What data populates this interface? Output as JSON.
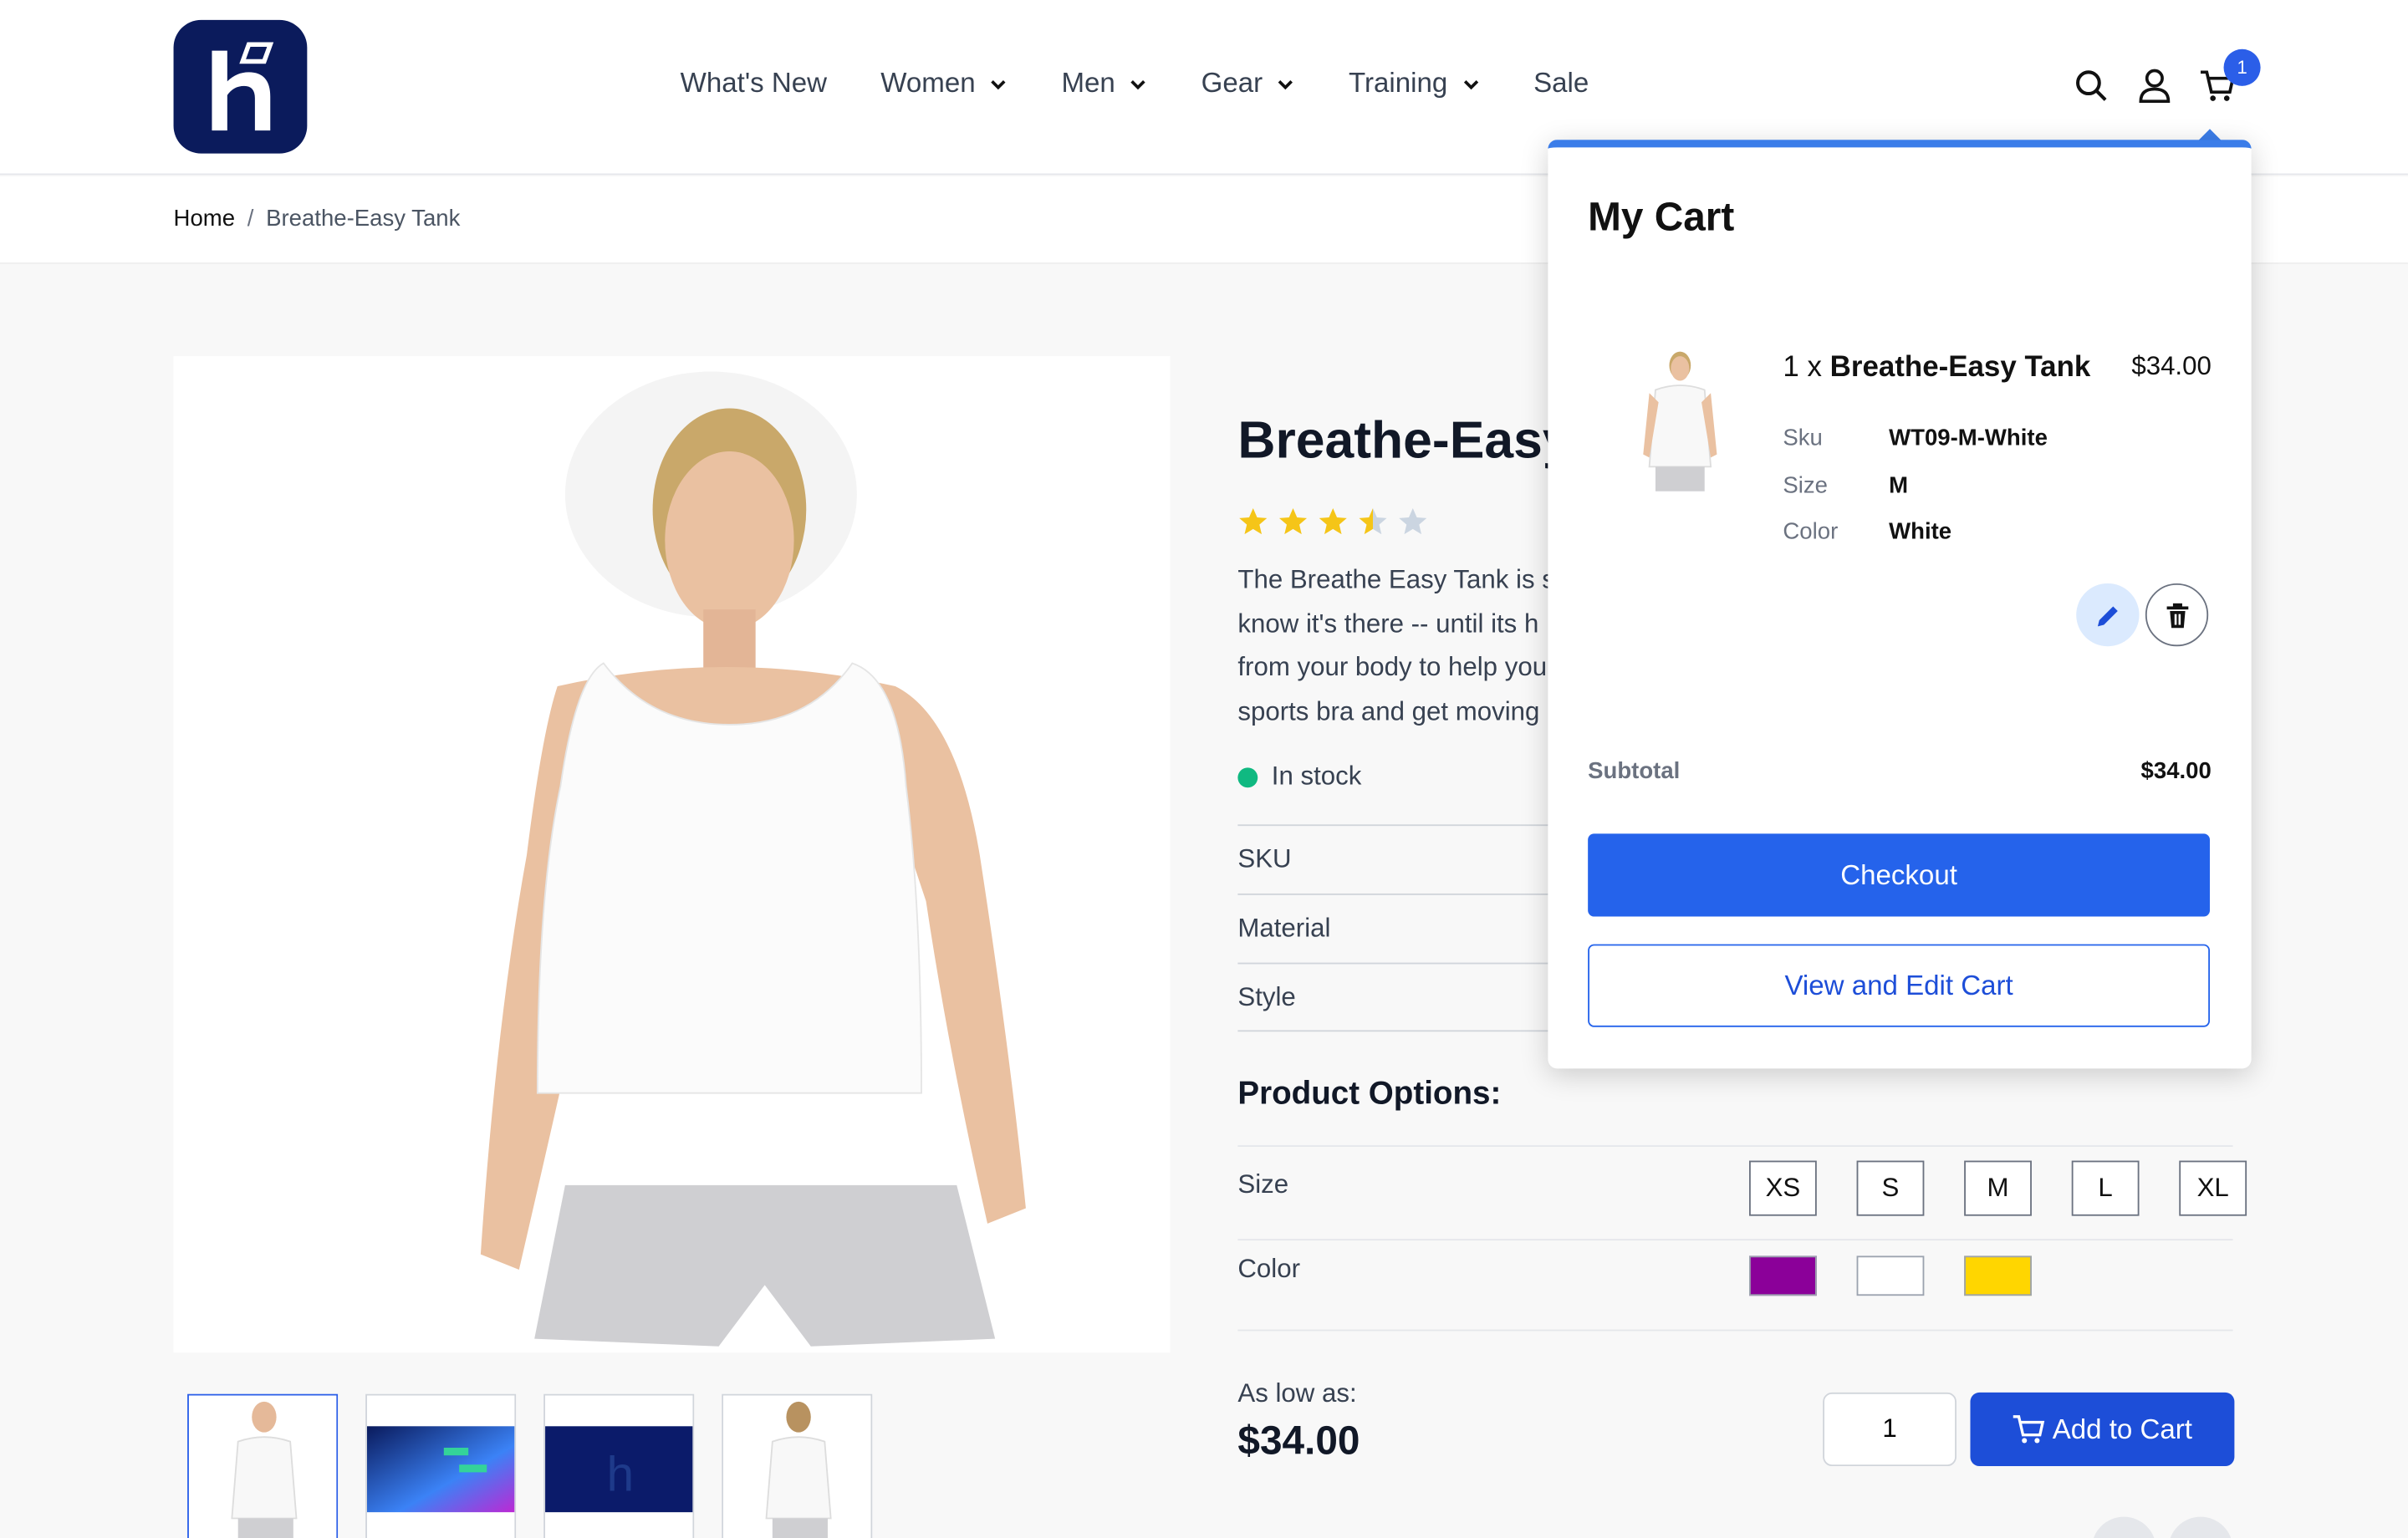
{
  "header": {
    "logo_icon": "hyva-h-logo",
    "nav": [
      {
        "label": "What's New",
        "has_dropdown": false
      },
      {
        "label": "Women",
        "has_dropdown": true
      },
      {
        "label": "Men",
        "has_dropdown": true
      },
      {
        "label": "Gear",
        "has_dropdown": true
      },
      {
        "label": "Training",
        "has_dropdown": true
      },
      {
        "label": "Sale",
        "has_dropdown": false
      }
    ],
    "icons": [
      "search-icon",
      "account-icon",
      "cart-icon"
    ],
    "cart_count": "1"
  },
  "breadcrumb": {
    "home": "Home",
    "separator": "/",
    "current": "Breathe-Easy Tank"
  },
  "product": {
    "title": "Breathe-Easy Tank",
    "rating_stars": 3.5,
    "rating_max": 5,
    "description_lines": [
      "The Breathe Easy Tank is s",
      "know it's there -- until its h",
      "from your body to help you",
      "sports bra and get moving"
    ],
    "stock": "In stock",
    "attributes": [
      "SKU",
      "Material",
      "Style"
    ],
    "options_heading": "Product Options:",
    "size_label": "Size",
    "sizes": [
      "XS",
      "S",
      "M",
      "L",
      "XL"
    ],
    "color_label": "Color",
    "colors": [
      "#8b0099",
      "#ffffff",
      "#ffd600"
    ],
    "as_low_as": "As low as:",
    "price": "$34.00",
    "qty": "1",
    "add_to_cart": "Add to Cart"
  },
  "mini_cart": {
    "title": "My Cart",
    "item": {
      "qty_prefix": "1 x",
      "name": "Breathe-Easy Tank",
      "price": "$34.00",
      "options": [
        {
          "label": "Sku",
          "value": "WT09-M-White"
        },
        {
          "label": "Size",
          "value": "M"
        },
        {
          "label": "Color",
          "value": "White"
        }
      ]
    },
    "subtotal_label": "Subtotal",
    "subtotal_value": "$34.00",
    "checkout": "Checkout",
    "view_edit": "View and Edit Cart"
  },
  "colors": {
    "brand_navy": "#0b1b5c",
    "accent_blue": "#2563eb",
    "stock_green": "#10b981",
    "star_yellow": "#f5c518"
  }
}
